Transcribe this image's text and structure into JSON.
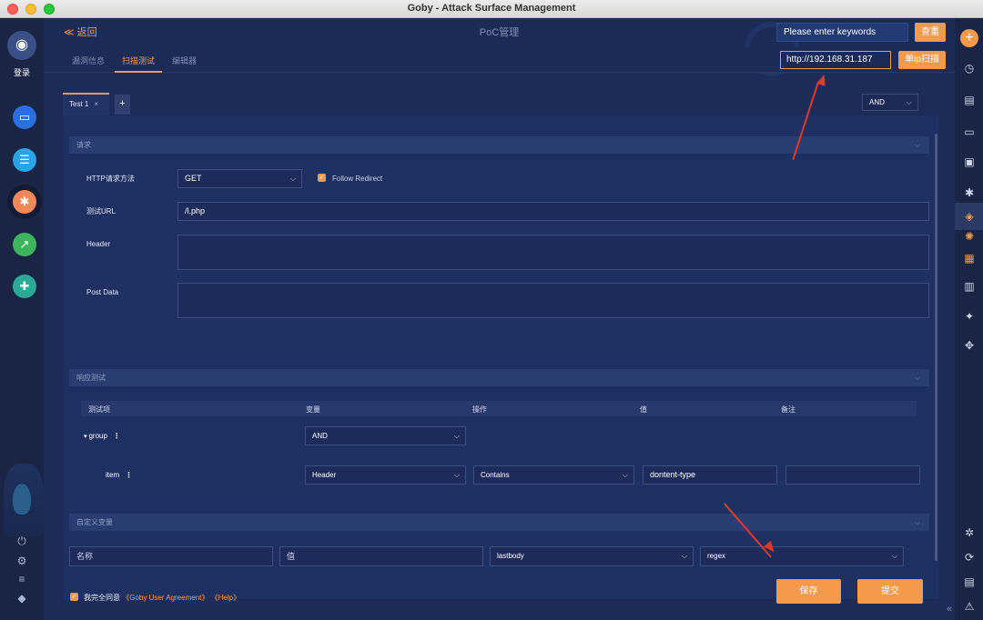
{
  "window": {
    "title": "Goby - Attack Surface Management"
  },
  "left_sidebar": {
    "login_label": "登录"
  },
  "header": {
    "back_label": "≪ 返回",
    "page_title": "PoC管理",
    "search_placeholder": "Please enter keywords",
    "search_button": "查重"
  },
  "tabs": [
    {
      "label": "漏洞信息",
      "active": false
    },
    {
      "label": "扫描测试",
      "active": true
    },
    {
      "label": "编辑器",
      "active": false
    }
  ],
  "target": {
    "ip_value": "http://192.168.31.187",
    "scan_button": "单ip扫描"
  },
  "test_tabs": {
    "tab_label": "Test 1",
    "close": "×",
    "add": "+"
  },
  "logic_select": "AND",
  "request_section": {
    "title": "请求",
    "method_label": "HTTP请求方法",
    "method_value": "GET",
    "follow_redirect_label": "Follow Redirect",
    "follow_redirect_checked": true,
    "url_label": "测试URL",
    "url_value": "/l.php",
    "header_label": "Header",
    "post_data_label": "Post Data"
  },
  "response_section": {
    "title": "响应测试",
    "columns": [
      "测试项",
      "变量",
      "操作",
      "值",
      "备注"
    ],
    "group_label": "group",
    "group_operator": "AND",
    "item_label": "item",
    "item_variable": "Header",
    "item_operation": "Contains",
    "item_value": "dontent-type",
    "item_note": ""
  },
  "custom_vars_section": {
    "title": "自定义变量",
    "name_placeholder": "名称",
    "value_placeholder": "值",
    "source_value": "lastbody",
    "type_value": "regex"
  },
  "footer": {
    "agree_text": "我完全同意",
    "agreement_link": "《Goby User Agreement》",
    "help_link": "《Help》",
    "save_button": "保存",
    "submit_button": "提交"
  },
  "colors": {
    "accent": "#f59a4a",
    "background": "#1c2b58",
    "annotation_arrow": "#e03a2a"
  }
}
